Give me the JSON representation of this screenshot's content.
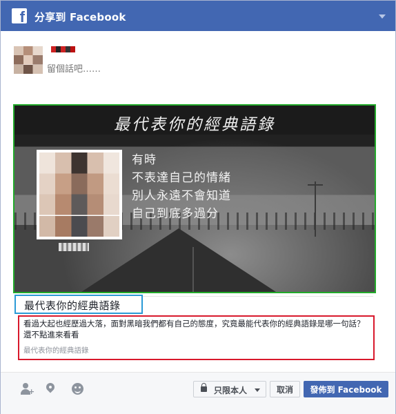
{
  "header": {
    "logo": "f",
    "title": "分享到 Facebook"
  },
  "composer": {
    "placeholder": "留個話吧……"
  },
  "preview": {
    "banner": "最代表你的經典語錄",
    "quote_lines": [
      "有時",
      "不表達自己的情緒",
      "別人永遠不會知道",
      "自己到底多過分"
    ]
  },
  "link": {
    "title": "最代表你的經典語錄",
    "description": "看過大起也經歷過大落，面對黑暗我們都有自己的態度，究竟最能代表你的經典語錄是哪一句話？還不點進來看看",
    "domain": "最代表你的經典語錄"
  },
  "footer": {
    "privacy_label": "只限本人",
    "cancel_label": "取消",
    "post_label": "發佈到 Facebook"
  },
  "colors": {
    "brand": "#4267b2",
    "image_highlight": "#22aa2a",
    "title_highlight": "#2a9ad6",
    "description_highlight": "#d8182b"
  }
}
